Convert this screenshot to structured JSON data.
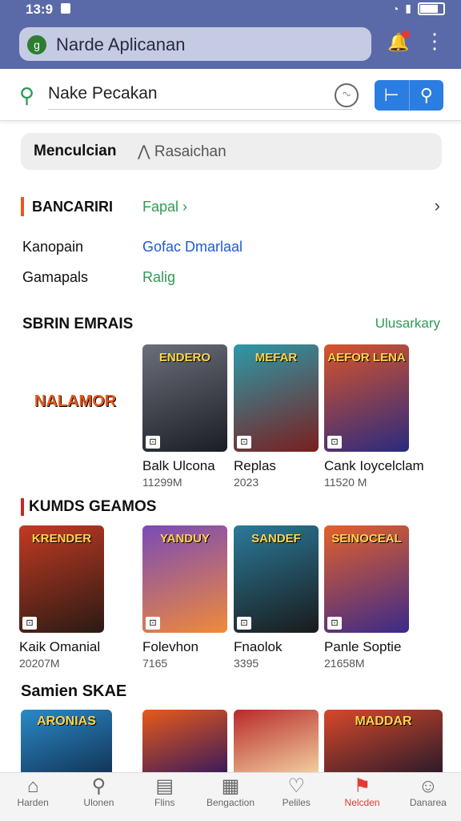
{
  "status": {
    "time": "13:9"
  },
  "browser": {
    "title": "Narde Aplicanan",
    "menu_glyph": "⋮"
  },
  "search": {
    "query": "Nake Pecakan"
  },
  "tabs": {
    "active": "Menculcian",
    "other": "Rasaichan"
  },
  "section1": {
    "heading": "BANCARIRI",
    "link": "Fapal",
    "rows": [
      {
        "key": "Kanopain",
        "value": "Gofac Dmarlaal",
        "color": "#1e5bd8"
      },
      {
        "key": "Gamapals",
        "value": "Ralig",
        "color": "#2e9a54"
      }
    ]
  },
  "section2": {
    "heading": "SBRIN EMRAIS",
    "more": "Ulusarkary",
    "items": [
      {
        "name": "",
        "size": "",
        "title": "NALAMOR",
        "colors": [
          "#ffffff",
          "#ffffff"
        ]
      },
      {
        "name": "Balk Ulcona",
        "size": "11299M",
        "title": "ENDERO",
        "colors": [
          "#6b6f7a",
          "#1b1d24"
        ]
      },
      {
        "name": "Replas",
        "size": "2023",
        "title": "MEFAR",
        "colors": [
          "#2c9aa8",
          "#7a1e1e"
        ]
      },
      {
        "name": "Cank Ioycelclam",
        "size": "11520 M",
        "title": "AEFOR LENA",
        "colors": [
          "#d8542a",
          "#2a2a80"
        ]
      }
    ]
  },
  "section3": {
    "heading": "KUMDS GEAMOS",
    "items": [
      {
        "name": "Kaik Omanial",
        "size": "20207M",
        "title": "KRENDER",
        "colors": [
          "#c23a22",
          "#2a1a14"
        ]
      },
      {
        "name": "Folevhon",
        "size": "7165",
        "title": "YANDUY",
        "colors": [
          "#7a4ab8",
          "#f08a3a"
        ]
      },
      {
        "name": "Fnaolok",
        "size": "3395",
        "title": "SANDEF",
        "colors": [
          "#2a7a9a",
          "#1a1a1a"
        ]
      },
      {
        "name": "Panle Soptie",
        "size": "21658M",
        "title": "SEINOCEAL",
        "colors": [
          "#e3612a",
          "#3a2a8a"
        ]
      }
    ]
  },
  "section4": {
    "heading": "Samien SKAE",
    "items": [
      {
        "title": "ARONIAS",
        "colors": [
          "#2a8ac8",
          "#123456"
        ]
      },
      {
        "title": "",
        "colors": [
          "#e85a1a",
          "#3a1a5a"
        ]
      },
      {
        "title": "",
        "colors": [
          "#b82a2a",
          "#f2d0a0"
        ]
      },
      {
        "title": "MADDAR",
        "colors": [
          "#d8482a",
          "#2a1a2a"
        ]
      }
    ]
  },
  "nav": [
    {
      "label": "Harden",
      "icon": "home-icon",
      "glyph": "⌂"
    },
    {
      "label": "Ulonen",
      "icon": "search-icon",
      "glyph": "⚲"
    },
    {
      "label": "Flins",
      "icon": "file-icon",
      "glyph": "▤"
    },
    {
      "label": "Bengaction",
      "icon": "grid-icon",
      "glyph": "▦"
    },
    {
      "label": "Peliles",
      "icon": "heart-icon",
      "glyph": "♡"
    },
    {
      "label": "Nelcden",
      "icon": "pin-icon",
      "glyph": "⚑",
      "active": true
    },
    {
      "label": "Danarea",
      "icon": "person-icon",
      "glyph": "☺"
    }
  ]
}
